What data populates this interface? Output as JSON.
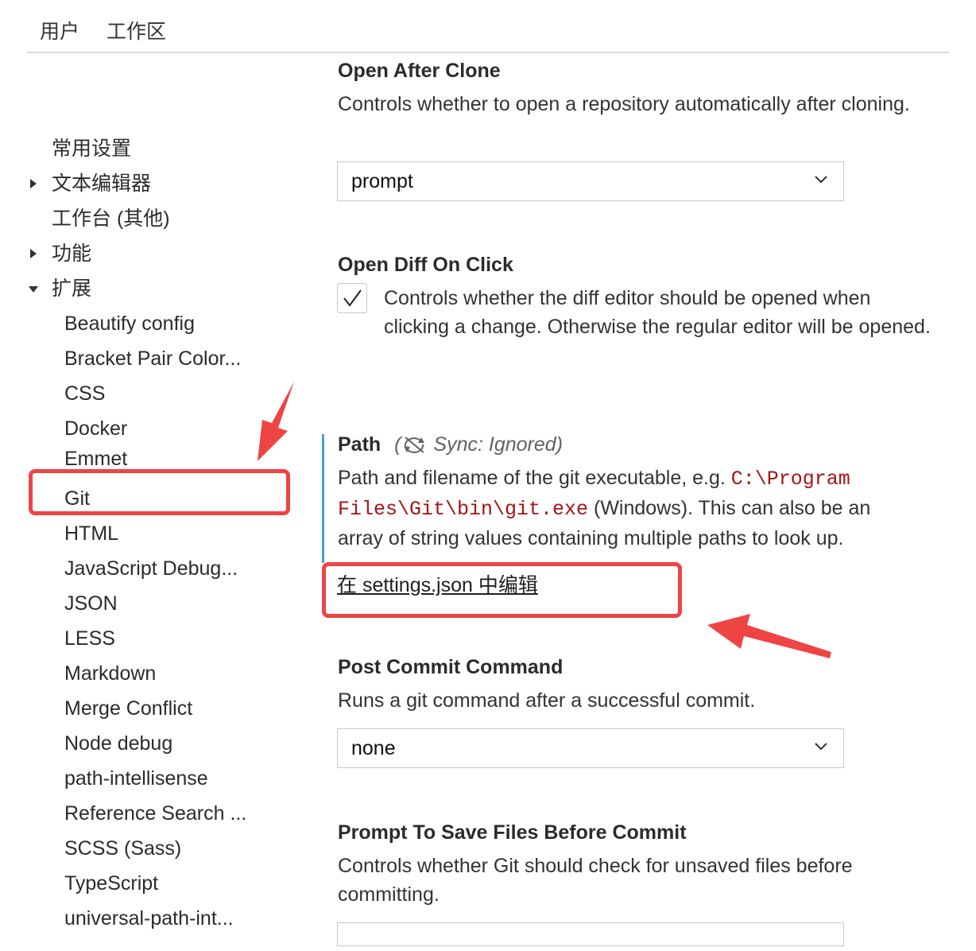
{
  "tabs": {
    "user": "用户",
    "workspace": "工作区"
  },
  "sidebar": {
    "items": [
      {
        "label": "常用设置"
      },
      {
        "label": "文本编辑器",
        "twisty": "collapsed"
      },
      {
        "label": "工作台 (其他)"
      },
      {
        "label": "功能",
        "twisty": "collapsed"
      },
      {
        "label": "扩展",
        "twisty": "expanded"
      }
    ],
    "extensions": [
      "Beautify config",
      "Bracket Pair Color...",
      "CSS",
      "Docker",
      "Emmet",
      "Git",
      "HTML",
      "JavaScript Debug...",
      "JSON",
      "LESS",
      "Markdown",
      "Merge Conflict",
      "Node debug",
      "path-intellisense",
      "Reference Search ...",
      "SCSS (Sass)",
      "TypeScript",
      "universal-path-int..."
    ],
    "selected": "Git"
  },
  "settings": {
    "open_after_clone": {
      "title": "Open After Clone",
      "description": "Controls whether to open a repository automatically after cloning.",
      "value": "prompt"
    },
    "open_diff_on_click": {
      "title": "Open Diff On Click",
      "description": "Controls whether the diff editor should be opened when clicking a change. Otherwise the regular editor will be opened.",
      "checked": true
    },
    "path": {
      "title": "Path",
      "sync": "Sync: Ignored",
      "desc_before": "Path and filename of the git executable, e.g. ",
      "code": "C:\\Program Files\\Git\\bin\\git.exe",
      "desc_after": " (Windows). This can also be an array of string values containing multiple paths to look up.",
      "edit_link": "在 settings.json 中编辑"
    },
    "post_commit_command": {
      "title": "Post Commit Command",
      "description": "Runs a git command after a successful commit.",
      "value": "none"
    },
    "prompt_to_save": {
      "title": "Prompt To Save Files Before Commit",
      "description": "Controls whether Git should check for unsaved files before committing."
    }
  },
  "colors": {
    "annotation_red": "#ee4444",
    "modified_bar": "#4a9ee0",
    "code_red": "#a31515"
  }
}
